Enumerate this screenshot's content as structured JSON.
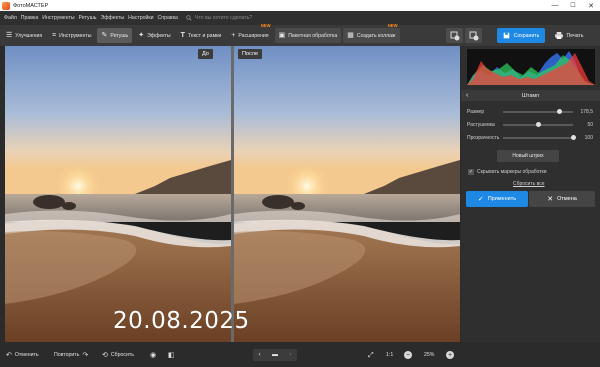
{
  "window": {
    "title": "ФотоМАСТЕР",
    "minimize": "—",
    "maximize": "☐",
    "close": "✕"
  },
  "menu": {
    "items": [
      "Файл",
      "Правка",
      "Инструменты",
      "Ретушь",
      "Эффекты",
      "Настройки",
      "Справка"
    ],
    "search_placeholder": "Что вы хотите сделать?"
  },
  "toolbar": {
    "tabs": [
      {
        "label": "Улучшения",
        "icon": "sliders-icon"
      },
      {
        "label": "Инструменты",
        "icon": "crop-icon"
      },
      {
        "label": "Ретушь",
        "icon": "brush-icon",
        "active": true
      },
      {
        "label": "Эффекты",
        "icon": "sparkle-icon"
      },
      {
        "label": "Текст и рамки",
        "icon": "text-icon"
      },
      {
        "label": "Расширения",
        "icon": "plus-icon",
        "badge": "NEW"
      },
      {
        "label": "Пакетная обработка",
        "icon": "batch-icon"
      },
      {
        "label": "Создать коллаж",
        "icon": "collage-icon",
        "badge": "NEW"
      }
    ],
    "save_label": "Сохранить",
    "print_label": "Печать"
  },
  "canvas": {
    "before_label": "До",
    "after_label": "После",
    "date_stamp": "20.08.2025"
  },
  "panel": {
    "title": "Штамп",
    "sliders": [
      {
        "label": "Размер",
        "value": "178,5",
        "fraction": 0.8
      },
      {
        "label": "Растушевка",
        "value": "50",
        "fraction": 0.5
      },
      {
        "label": "Прозрачность",
        "value": "100",
        "fraction": 1.0
      }
    ],
    "new_stroke_label": "Новый штрих",
    "hide_markers_label": "Скрывать маркеры обработки",
    "hide_markers_checked": true,
    "reset_label": "Сбросить все",
    "apply_label": "Применить",
    "cancel_label": "Отмена"
  },
  "bottom": {
    "undo_label": "Отменить",
    "redo_label": "Повторить",
    "reset_label": "Сбросить",
    "ratio_label": "1:1",
    "zoom": "25%"
  },
  "colors": {
    "accent": "#1e88e5",
    "badge": "#ff8a1e"
  }
}
